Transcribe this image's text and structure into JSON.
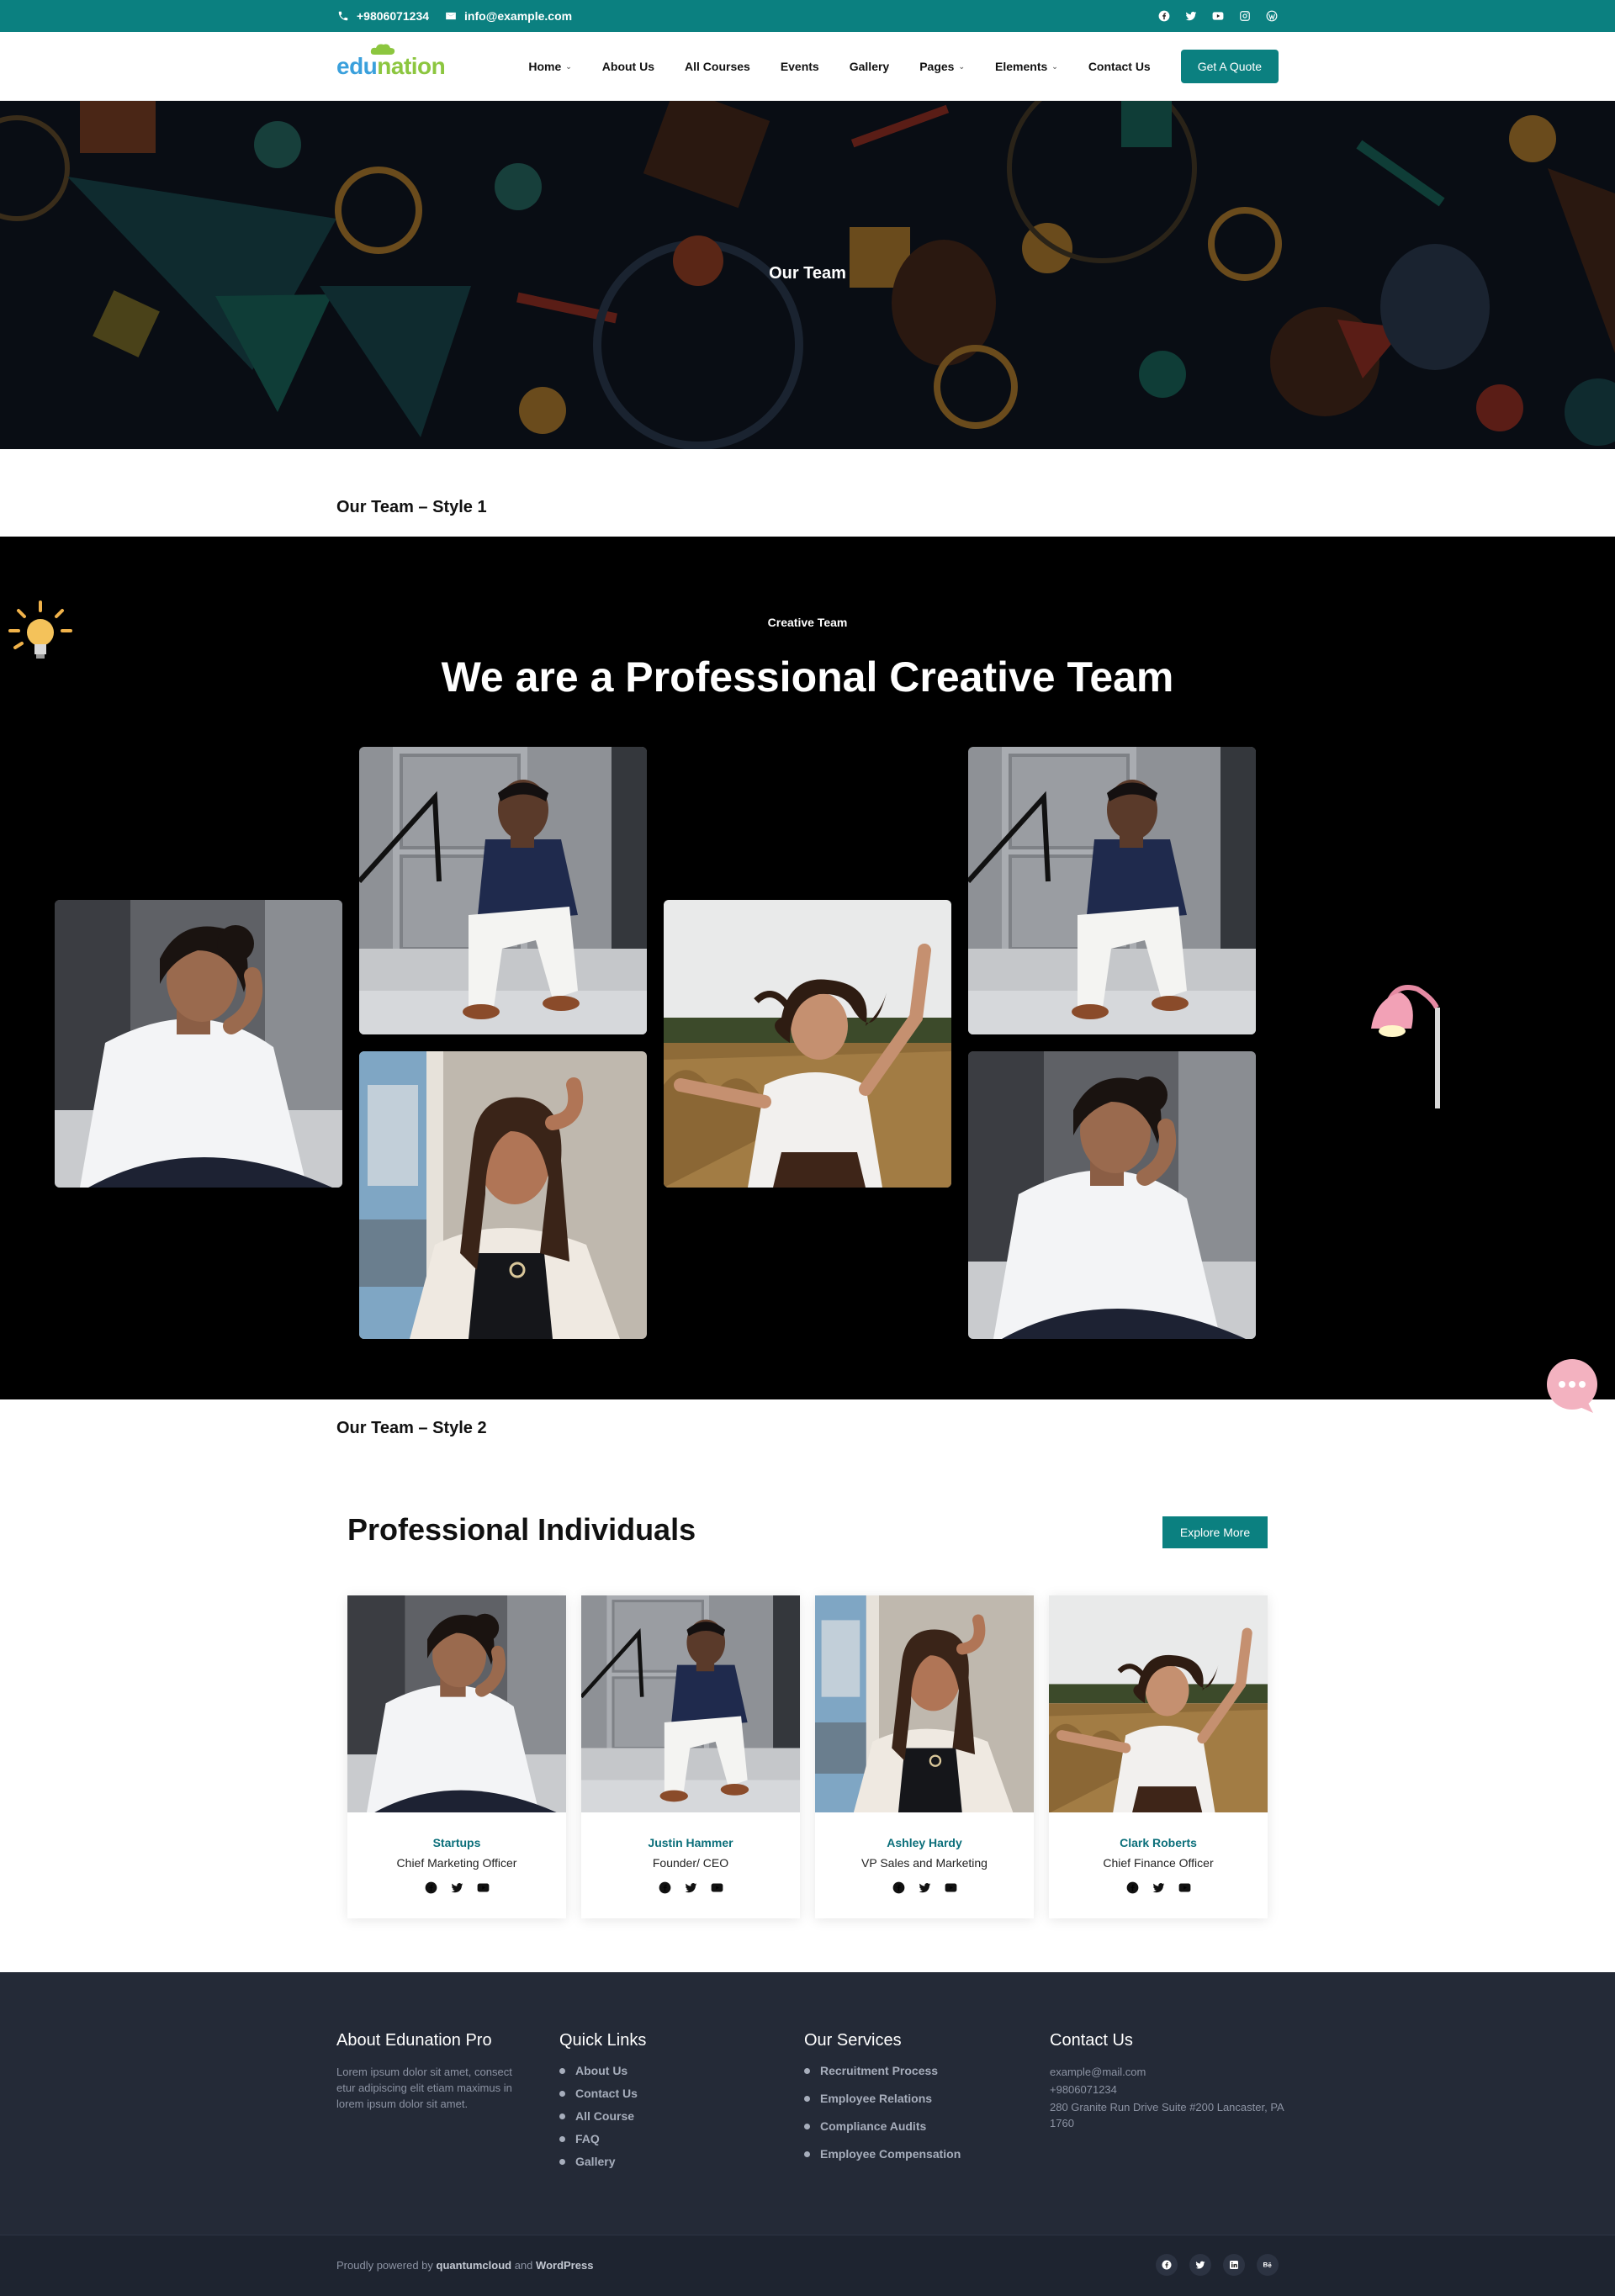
{
  "topbar": {
    "phone": "+9806071234",
    "email": "info@example.com",
    "social_icons": [
      "facebook-icon",
      "twitter-icon",
      "youtube-icon",
      "instagram-icon",
      "wordpress-icon"
    ]
  },
  "header": {
    "logo_edu": "edu",
    "logo_nation": "nation",
    "nav": {
      "home": "Home",
      "about": "About Us",
      "courses": "All Courses",
      "events": "Events",
      "gallery": "Gallery",
      "pages": "Pages",
      "elements": "Elements",
      "contact": "Contact Us"
    },
    "cta": "Get A Quote"
  },
  "hero": {
    "title": "Our Team"
  },
  "style1": {
    "label": "Our Team – Style 1",
    "eyebrow": "Creative Team",
    "headline": "We are a Professional Creative Team"
  },
  "style2": {
    "label": "Our Team – Style 2",
    "title": "Professional Individuals",
    "button": "Explore More",
    "members": [
      {
        "name": "Startups",
        "role": "Chief Marketing Officer"
      },
      {
        "name": "Justin Hammer",
        "role": "Founder/ CEO"
      },
      {
        "name": "Ashley Hardy",
        "role": "VP Sales and Marketing"
      },
      {
        "name": "Clark Roberts",
        "role": "Chief Finance Officer"
      }
    ]
  },
  "footer": {
    "about": {
      "title": "About Edunation Pro",
      "text": "Lorem ipsum dolor sit amet, consect etur adipiscing elit etiam maximus in lorem ipsum dolor sit amet."
    },
    "quick_links": {
      "title": "Quick Links",
      "items": [
        "About Us",
        "Contact Us",
        "All Course",
        "FAQ",
        "Gallery"
      ]
    },
    "services": {
      "title": "Our Services",
      "items": [
        "Recruitment Process",
        "Employee Relations",
        "Compliance Audits",
        "Employee Compensation"
      ]
    },
    "contact": {
      "title": "Contact Us",
      "email": "example@mail.com",
      "phone": "+9806071234",
      "address": "280 Granite Run Drive Suite #200 Lancaster, PA 1760"
    },
    "copyright_prefix": "Proudly powered by",
    "copyright_brand": "quantumcloud",
    "copyright_and": "and",
    "copyright_platform": "WordPress",
    "social_icons": [
      "facebook-icon",
      "twitter-icon",
      "linkedin-icon",
      "behance-icon"
    ]
  },
  "colors": {
    "accent": "#0b8080",
    "hero_bg": "#090d14",
    "footer_bg": "#242a37",
    "member_name": "#0b6f7a"
  }
}
